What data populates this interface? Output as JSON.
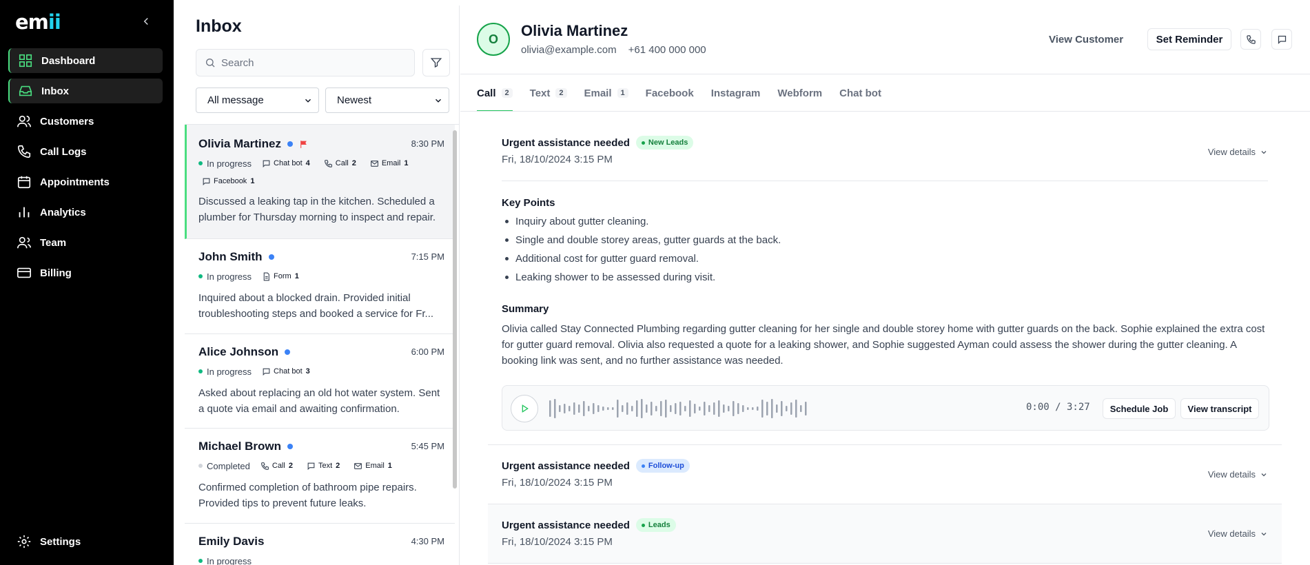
{
  "sidebar": {
    "logo_text": "em",
    "logo_accent": "ii",
    "items": [
      {
        "label": "Dashboard",
        "icon": "grid-icon"
      },
      {
        "label": "Inbox",
        "icon": "inbox-icon"
      },
      {
        "label": "Customers",
        "icon": "users-icon"
      },
      {
        "label": "Call Logs",
        "icon": "phone-icon"
      },
      {
        "label": "Appointments",
        "icon": "calendar-icon"
      },
      {
        "label": "Analytics",
        "icon": "bar-chart-icon"
      },
      {
        "label": "Team",
        "icon": "team-icon"
      },
      {
        "label": "Billing",
        "icon": "card-icon"
      }
    ],
    "settings_label": "Settings"
  },
  "inbox": {
    "title": "Inbox",
    "search_placeholder": "Search",
    "filter_selected": "All message",
    "sort_selected": "Newest",
    "conversations": [
      {
        "name": "Olivia Martinez",
        "time": "8:30 PM",
        "status": "In progress",
        "flagged": true,
        "channels": [
          {
            "label": "Chat bot",
            "count": "4"
          },
          {
            "label": "Call",
            "count": "2"
          },
          {
            "label": "Email",
            "count": "1"
          },
          {
            "label": "Facebook",
            "count": "1"
          }
        ],
        "preview": "Discussed a leaking tap in the kitchen. Scheduled a plumber for Thursday morning to inspect and repair."
      },
      {
        "name": "John Smith",
        "time": "7:15 PM",
        "status": "In progress",
        "channels": [
          {
            "label": "Form",
            "count": "1"
          }
        ],
        "preview": "Inquired about a blocked drain. Provided initial troubleshooting steps and booked a service for Fr..."
      },
      {
        "name": "Alice Johnson",
        "time": "6:00 PM",
        "status": "In progress",
        "channels": [
          {
            "label": "Chat bot",
            "count": "3"
          }
        ],
        "preview": "Asked about replacing an old hot water system. Sent a quote via email and awaiting confirmation."
      },
      {
        "name": "Michael Brown",
        "time": "5:45 PM",
        "status": "Completed",
        "channels": [
          {
            "label": "Call",
            "count": "2"
          },
          {
            "label": "Text",
            "count": "2"
          },
          {
            "label": "Email",
            "count": "1"
          }
        ],
        "preview": "Confirmed completion of bathroom pipe repairs. Provided tips to prevent future leaks."
      },
      {
        "name": "Emily Davis",
        "time": "4:30 PM",
        "status": "In progress",
        "channels": [],
        "preview": ""
      }
    ]
  },
  "contact": {
    "initial": "O",
    "name": "Olivia Martinez",
    "email": "olivia@example.com",
    "phone": "+61 400 000 000",
    "view_customer": "View Customer",
    "set_reminder": "Set Reminder"
  },
  "tabs": [
    {
      "label": "Call",
      "badge": "2"
    },
    {
      "label": "Text",
      "badge": "2"
    },
    {
      "label": "Email",
      "badge": "1"
    },
    {
      "label": "Facebook",
      "badge": ""
    },
    {
      "label": "Instagram",
      "badge": ""
    },
    {
      "label": "Webform",
      "badge": ""
    },
    {
      "label": "Chat bot",
      "badge": ""
    }
  ],
  "calls": [
    {
      "title": "Urgent assistance needed",
      "tag": "New Leads",
      "tag_color": "#16a34a",
      "date": "Fri, 18/10/2024 3:15 PM",
      "view_details": "View details",
      "key_points_heading": "Key Points",
      "key_points": [
        "Inquiry about gutter cleaning.",
        "Single and double storey areas, gutter guards at the back.",
        "Additional cost for gutter guard removal.",
        "Leaking shower to be assessed during visit."
      ],
      "summary_heading": "Summary",
      "summary": "Olivia called Stay Connected Plumbing regarding gutter cleaning for her single and double storey home with gutter guards on the back. Sophie explained the extra cost for gutter guard removal. Olivia also requested a quote for a leaking shower, and Sophie suggested Ayman could assess the shower during the gutter cleaning. A booking link was sent, and no further assistance was needed.",
      "player": {
        "time": "0:00 / 3:27",
        "schedule_job": "Schedule Job",
        "view_transcript": "View transcript"
      }
    },
    {
      "title": "Urgent assistance needed",
      "tag": "Follow-up",
      "tag_color": "#3b82f6",
      "date": "Fri, 18/10/2024 3:15 PM",
      "view_details": "View details"
    },
    {
      "title": "Urgent assistance needed",
      "tag": "Leads",
      "tag_color": "#16a34a",
      "date": "Fri, 18/10/2024 3:15 PM",
      "view_details": "View details"
    }
  ],
  "colors": {
    "accent": "#4ade80",
    "sidebar_bg": "#000000",
    "unread_dot": "#3b82f6",
    "flag": "#ef4444"
  }
}
